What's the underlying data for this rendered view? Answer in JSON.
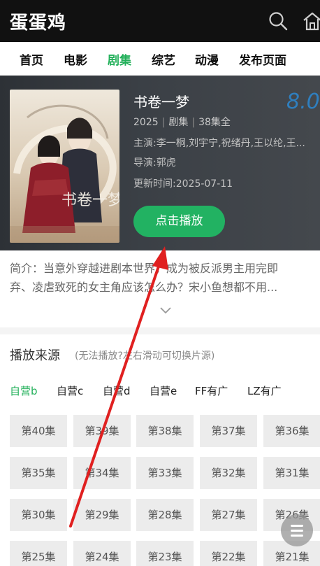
{
  "app": {
    "title": "蛋蛋鸡"
  },
  "icons": {
    "search": "search-icon",
    "home": "home-icon",
    "menu": "menu-icon",
    "expand": "chevron-down-icon"
  },
  "nav": {
    "items": [
      {
        "label": "首页"
      },
      {
        "label": "电影"
      },
      {
        "label": "剧集"
      },
      {
        "label": "综艺"
      },
      {
        "label": "动漫"
      },
      {
        "label": "发布页面"
      }
    ],
    "active_index": 2
  },
  "detail": {
    "title": "书卷一梦",
    "score": "8.0",
    "year": "2025",
    "category": "剧集",
    "episodes_status": "38集全",
    "actors": "主演:李一桐,刘宇宁,祝绪丹,王以纶,王...",
    "director": "导演:郭虎",
    "updated": "更新时间:2025-07-11",
    "play_label": "点击播放",
    "poster_text": "书卷一梦"
  },
  "intro": {
    "line1": "简介：当意外穿越进剧本世界，成为被反派男主用完即",
    "line2": "弃、凌虐致死的女主角应该怎么办？宋小鱼想都不用..."
  },
  "sources": {
    "title": "播放来源",
    "hint": "(无法播放?左右滑动可切换片源)",
    "tabs": [
      "自营b",
      "自营c",
      "自营d",
      "自营e",
      "FF有广",
      "LZ有广"
    ],
    "active_index": 0
  },
  "episodes": [
    "第40集",
    "第39集",
    "第38集",
    "第37集",
    "第36集",
    "第35集",
    "第34集",
    "第33集",
    "第32集",
    "第31集",
    "第30集",
    "第29集",
    "第28集",
    "第27集",
    "第26集",
    "第25集",
    "第24集",
    "第23集",
    "第22集",
    "第21集"
  ],
  "colors": {
    "accent": "#22b05a",
    "topbar": "#111111",
    "hero": "#3b4046",
    "score": "#2f7fbf",
    "annotation_arrow": "#e02020"
  }
}
